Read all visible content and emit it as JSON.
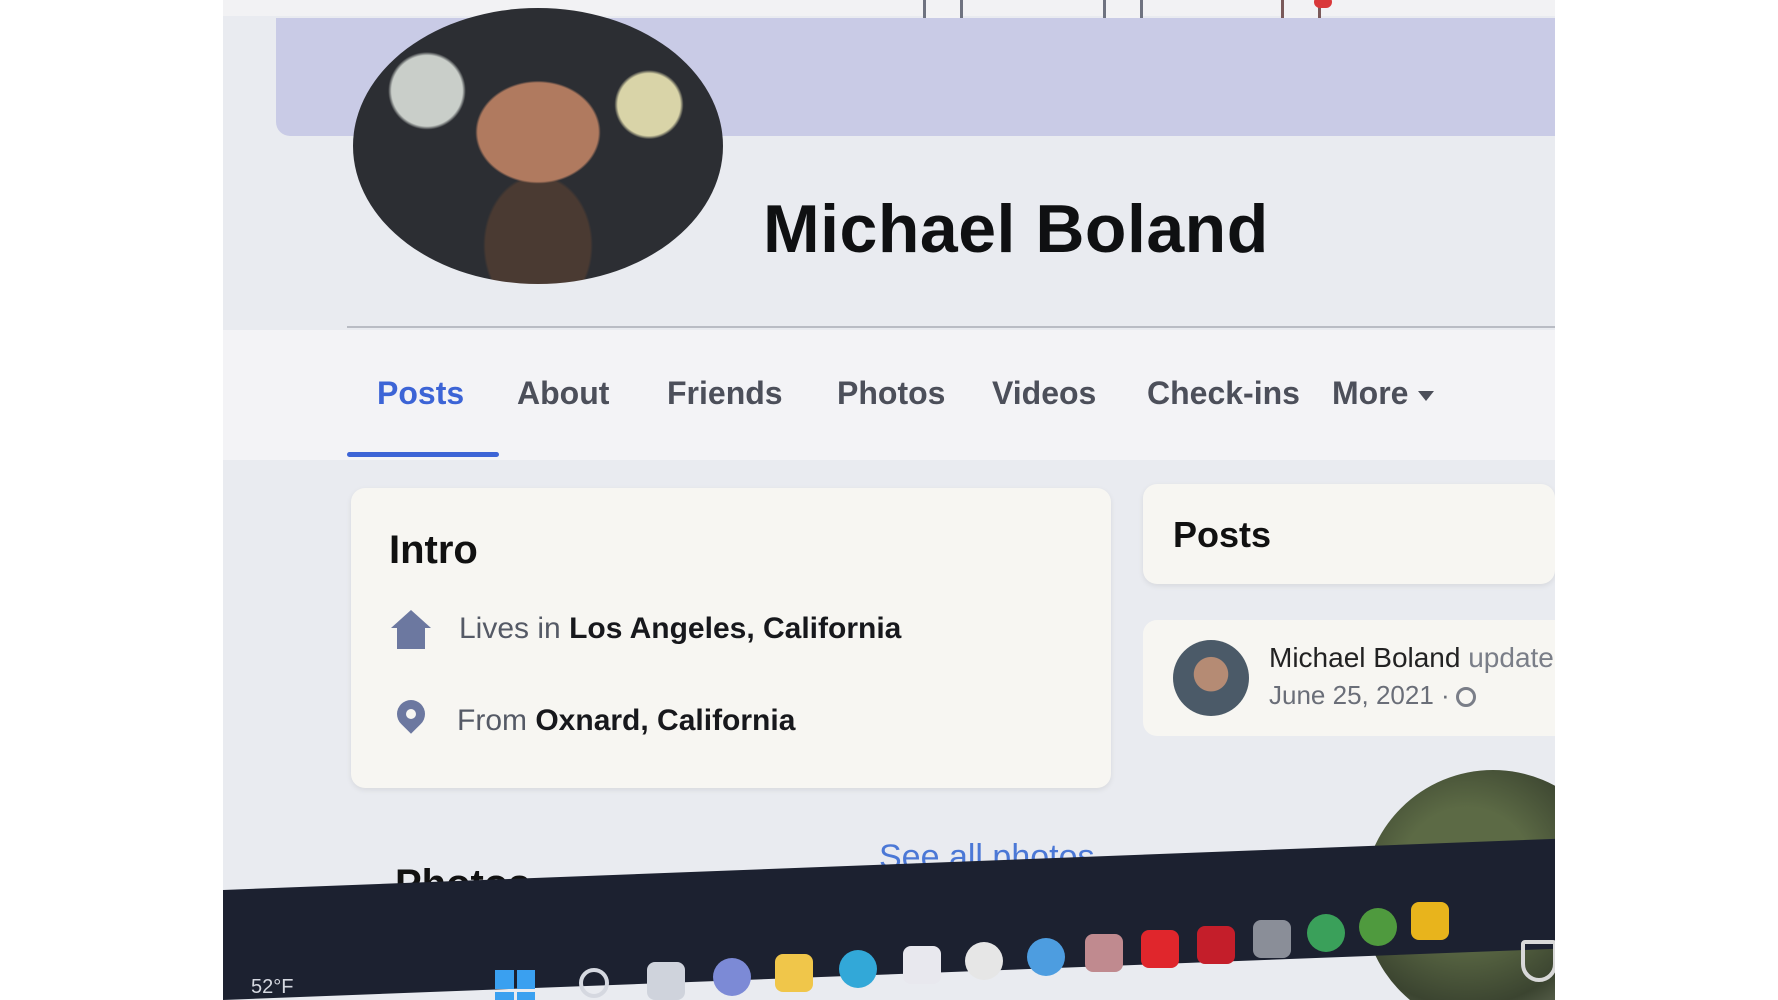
{
  "profile": {
    "name": "Michael Boland"
  },
  "tabs": [
    {
      "label": "Posts"
    },
    {
      "label": "About"
    },
    {
      "label": "Friends"
    },
    {
      "label": "Photos"
    },
    {
      "label": "Videos"
    },
    {
      "label": "Check-ins"
    },
    {
      "label": "More"
    }
  ],
  "intro": {
    "title": "Intro",
    "lives_prefix": "Lives in",
    "lives_value": "Los Angeles, California",
    "from_prefix": "From",
    "from_value": "Oxnard, California"
  },
  "photos": {
    "title": "Photos",
    "see_all": "See all photos"
  },
  "posts": {
    "title": "Posts",
    "item": {
      "author": "Michael Boland",
      "action": "updated",
      "date": "June 25, 2021 ·"
    }
  },
  "taskbar": {
    "weather": "52°F",
    "app_icons": [
      "windows-start-icon",
      "search-icon",
      "task-view-icon",
      "chat-icon",
      "file-explorer-icon",
      "edge-browser-icon",
      "store-icon",
      "app-icon",
      "help-icon",
      "app-icon",
      "youtube-icon",
      "mcafee-icon",
      "app-icon",
      "app-icon",
      "app-icon",
      "app-icon",
      "security-shield-icon"
    ]
  },
  "colors": {
    "accent": "#3c64d6",
    "link": "#4b78d6",
    "taskbar": "#1c2130"
  }
}
